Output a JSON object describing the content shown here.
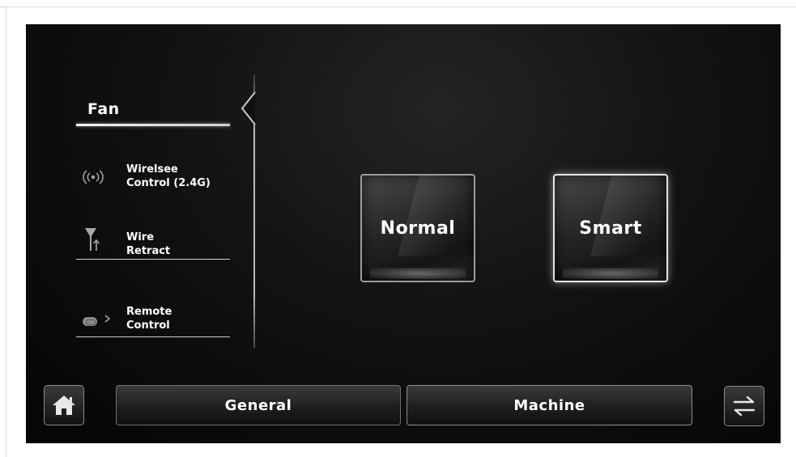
{
  "sidebar": {
    "fan_label": "Fan",
    "items": [
      {
        "line1": "Wirelsee",
        "line2": "Control (2.4G)",
        "icon": "wireless-signal-icon"
      },
      {
        "line1": "Wire",
        "line2": "Retract",
        "icon": "wire-retract-icon"
      },
      {
        "line1": "Remote",
        "line2": "Control",
        "icon": "remote-control-icon"
      }
    ]
  },
  "modes": {
    "normal_label": "Normal",
    "smart_label": "Smart",
    "selected": "Smart"
  },
  "bottom_bar": {
    "home_icon": "home-icon",
    "general_label": "General",
    "machine_label": "Machine",
    "swap_icon": "swap-arrows-icon"
  }
}
